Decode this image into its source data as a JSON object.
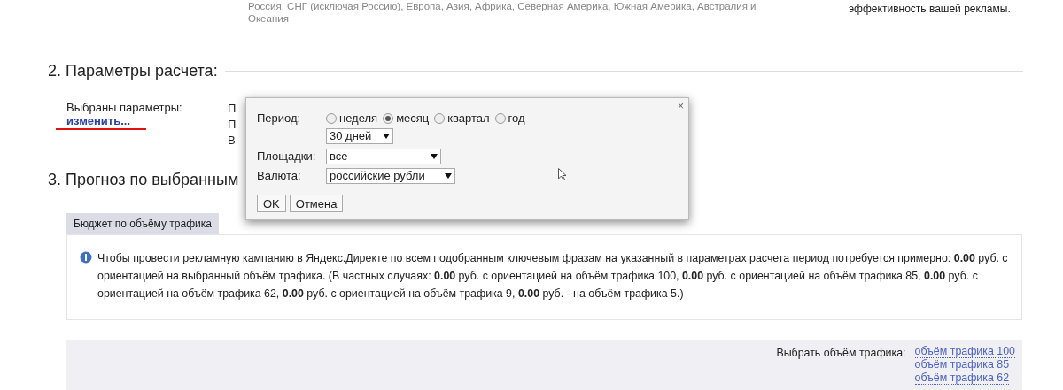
{
  "top_text": {
    "lines": [
      "Россия, СНГ (исключая Россию), Европа, Азия, Африка, Северная Америка, Южная Америка, Австралия и",
      "Океания"
    ],
    "side_note": "эффективность вашей рекламы."
  },
  "section2": {
    "heading": "2. Параметры расчета:",
    "label": "Выбраны параметры:",
    "change_link": "изменить...",
    "params_behind": [
      "П",
      "П",
      "В"
    ]
  },
  "section3": {
    "heading": "3. Прогноз по выбранным"
  },
  "tabs": [
    {
      "label": "Бюджет по объёму трафика",
      "selected": true
    }
  ],
  "info_text": "Чтобы провести рекламную кампанию в Яндекс.Директе по всем подобранным ключевым фразам на указанный в параметрах расчета период потребуется примерно: **0.00** руб. с ориентацией на выбранный объём трафика. (В частных случаях: **0.00** руб. с ориентацией на объём трафика 100, **0.00** руб. с ориентацией на объём трафика 85, **0.00** руб. с ориентацией на объём трафика 62, **0.00** руб. с ориентацией на объём трафика 9, **0.00** руб. - на объём трафика 5.)",
  "traffic": {
    "label": "Выбрать объём трафика:",
    "links": [
      "объём трафика 100",
      "объём трафика 85",
      "объём трафика 62"
    ]
  },
  "dialog": {
    "close": "×",
    "period_label": "Период:",
    "period_options": [
      {
        "label": "неделя",
        "selected": false
      },
      {
        "label": "месяц",
        "selected": true
      },
      {
        "label": "квартал",
        "selected": false
      },
      {
        "label": "год",
        "selected": false
      }
    ],
    "days": "30 дней",
    "sites_label": "Площадки:",
    "sites": "все",
    "currency_label": "Валюта:",
    "currency": "российские рубли",
    "ok": "OK",
    "cancel": "Отмена"
  }
}
